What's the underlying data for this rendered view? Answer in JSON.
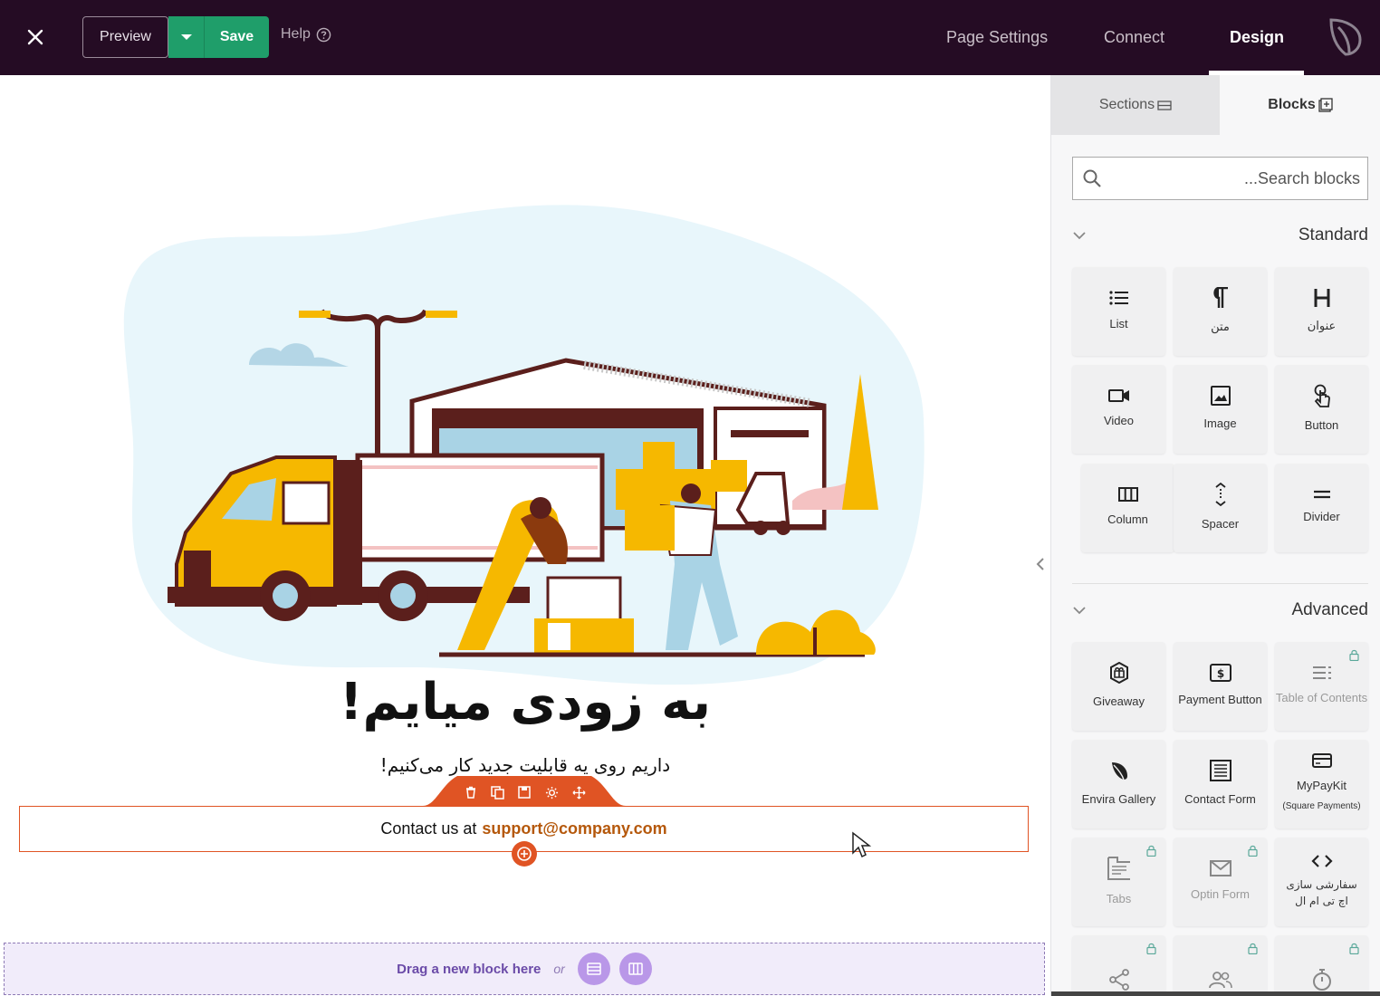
{
  "header": {
    "preview_label": "Preview",
    "save_label": "Save",
    "help_label": "Help",
    "nav": [
      "Page Settings",
      "Connect",
      "Design"
    ],
    "active_nav": "Design"
  },
  "canvas": {
    "headline": "به زودی میایم!",
    "subline": "داریم روی یه قابلیت جدید کار می‌کنیم!",
    "contact_prefix": "Contact us at",
    "contact_email": "support@company.com",
    "drop_text": "Drag a new block here",
    "drop_or": "or"
  },
  "sidebar": {
    "tabs": [
      {
        "label": "Sections",
        "icon": "sections-icon"
      },
      {
        "label": "Blocks",
        "icon": "blocks-plus-icon"
      }
    ],
    "search_placeholder": "...Search blocks",
    "standard_title": "Standard",
    "advanced_title": "Advanced",
    "standard_blocks": [
      {
        "label": "List",
        "icon": "list-icon"
      },
      {
        "label": "متن",
        "icon": "paragraph-icon"
      },
      {
        "label": "عنوان",
        "icon": "heading-icon"
      },
      {
        "label": "Video",
        "icon": "video-icon"
      },
      {
        "label": "Image",
        "icon": "image-icon"
      },
      {
        "label": "Button",
        "icon": "button-pointer-icon"
      },
      {
        "label": "Column",
        "icon": "column-icon"
      },
      {
        "label": "Spacer",
        "icon": "spacer-icon"
      },
      {
        "label": "Divider",
        "icon": "divider-icon"
      }
    ],
    "advanced_blocks": [
      {
        "label": "Giveaway",
        "icon": "giveaway-icon",
        "locked": false
      },
      {
        "label": "Payment Button",
        "icon": "payment-icon",
        "locked": false
      },
      {
        "label": "Table of Contents",
        "icon": "toc-icon",
        "locked": true
      },
      {
        "label": "Envira Gallery",
        "icon": "leaf-icon",
        "locked": false
      },
      {
        "label": "Contact Form",
        "icon": "form-icon",
        "locked": false
      },
      {
        "label": "MyPayKit",
        "sub": "(Square Payments)",
        "icon": "card-icon",
        "locked": false
      },
      {
        "label": "Tabs",
        "icon": "tabs-icon",
        "locked": true
      },
      {
        "label": "Optin Form",
        "icon": "mail-icon",
        "locked": true
      },
      {
        "label": "سفارشی سازی اچ تی ام ال",
        "icon": "code-icon",
        "locked": false
      },
      {
        "label": "",
        "icon": "share-icon",
        "locked": true
      },
      {
        "label": "",
        "icon": "users-icon",
        "locked": true
      },
      {
        "label": "",
        "icon": "timer-icon",
        "locked": true
      }
    ]
  },
  "colors": {
    "topbar": "#250c24",
    "save": "#1f9e6a",
    "accent_orange": "#e05424",
    "email": "#b5580b",
    "drop_zone": "#f1ecfa"
  }
}
